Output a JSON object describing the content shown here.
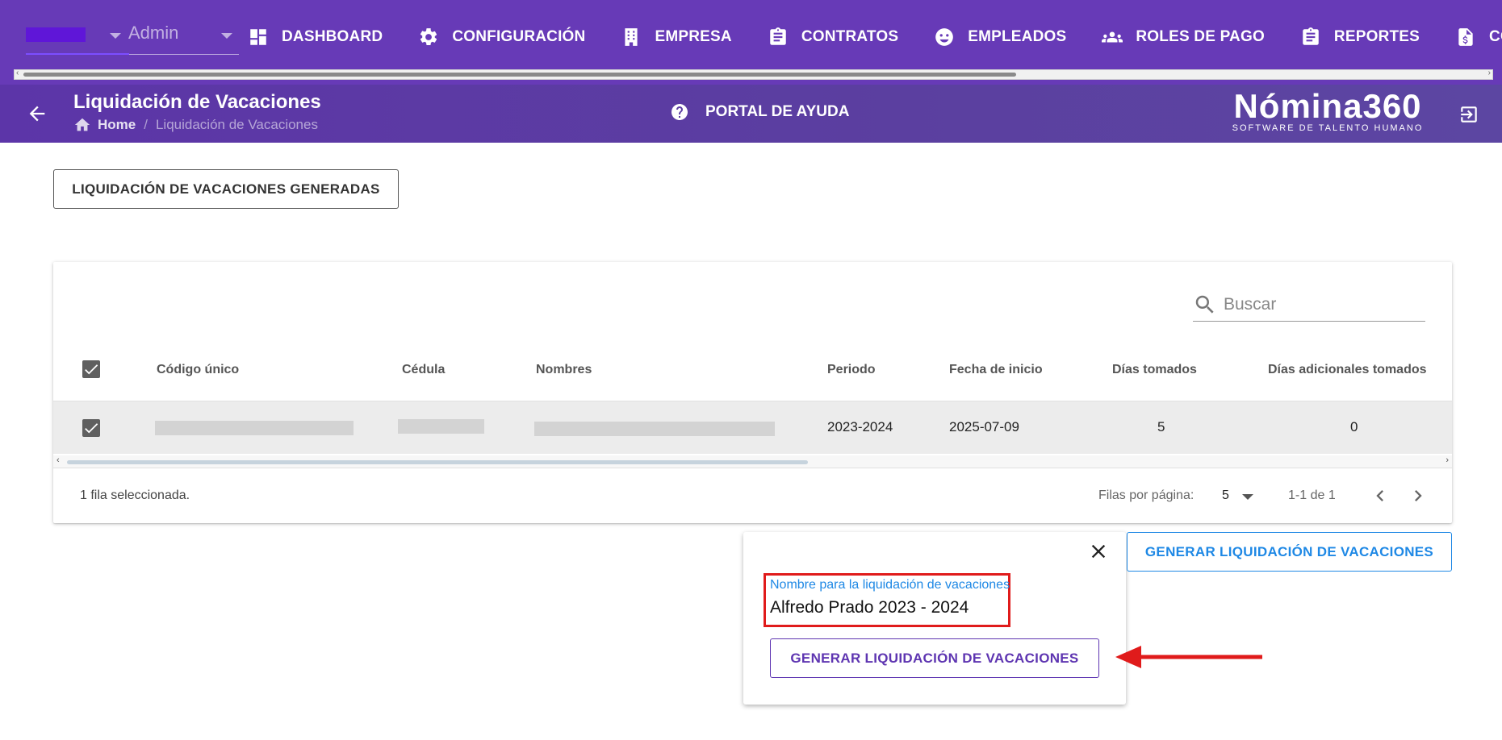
{
  "topnav": {
    "org_label": "Admin",
    "items": [
      {
        "label": "DASHBOARD",
        "icon": "dashboard-icon"
      },
      {
        "label": "CONFIGURACIÓN",
        "icon": "gear-icon"
      },
      {
        "label": "EMPRESA",
        "icon": "building-icon"
      },
      {
        "label": "CONTRATOS",
        "icon": "clipboard-icon"
      },
      {
        "label": "EMPLEADOS",
        "icon": "face-icon"
      },
      {
        "label": "ROLES DE PAGO",
        "icon": "group-icon"
      },
      {
        "label": "REPORTES",
        "icon": "clipboard-icon"
      },
      {
        "label": "COSTOS",
        "icon": "invoice-dollar-icon"
      }
    ],
    "accent": "#673ab7"
  },
  "header": {
    "title": "Liquidación de Vacaciones",
    "breadcrumb_home": "Home",
    "breadcrumb_sep": "/",
    "breadcrumb_current": "Liquidación de Vacaciones",
    "help_label": "PORTAL DE AYUDA",
    "brand_name": "Nómina360",
    "brand_tagline": "SOFTWARE DE TALENTO HUMANO"
  },
  "main": {
    "generated_button": "LIQUIDACIÓN DE VACACIONES GENERADAS",
    "search_placeholder": "Buscar",
    "columns": [
      "Código único",
      "Cédula",
      "Nombres",
      "Periodo",
      "Fecha de inicio",
      "Días tomados",
      "Días adicionales tomados"
    ],
    "rows": [
      {
        "codigo": "",
        "cedula": "",
        "nombres": "",
        "periodo": "2023-2024",
        "fecha_inicio": "2025-07-09",
        "dias_tomados": "5",
        "dias_adicionales": "0",
        "selected": true
      }
    ],
    "selection_text": "1 fila seleccionada.",
    "rows_per_page_label": "Filas por página:",
    "rows_per_page_value": "5",
    "range_text": "1-1 de 1",
    "generate_button": "GENERAR LIQUIDACIÓN DE VACACIONES"
  },
  "popover": {
    "field_label": "Nombre para la liquidación de vacaciones",
    "field_value": "Alfredo Prado 2023 - 2024",
    "submit_button": "GENERAR LIQUIDACIÓN DE VACACIONES",
    "highlight_color": "#e01b1b"
  }
}
